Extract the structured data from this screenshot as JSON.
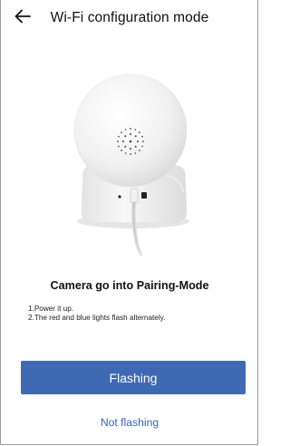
{
  "header": {
    "back_icon": "arrow-left-icon",
    "title": "Wi-Fi configuration mode"
  },
  "illustration": {
    "subject": "camera-illustration"
  },
  "instructions": {
    "title": "Camera go into Pairing-Mode",
    "steps": [
      "1.Power it up.",
      "2.The red and blue lights flash alternately."
    ]
  },
  "actions": {
    "primary_label": "Flashing",
    "secondary_label": "Not flashing"
  },
  "colors": {
    "primary": "#3f69b3",
    "link": "#3466ba",
    "text": "#111111"
  }
}
